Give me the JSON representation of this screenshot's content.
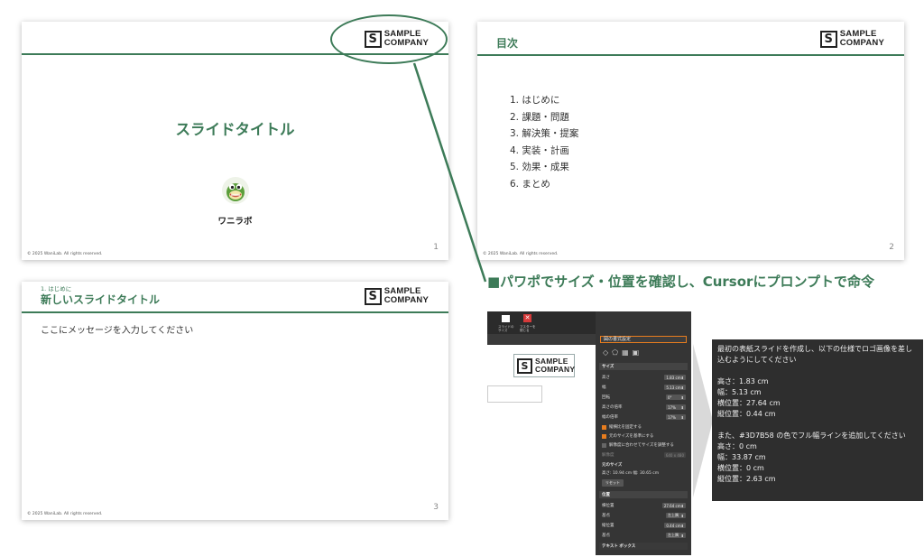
{
  "brand": {
    "mark": "S",
    "line1": "SAMPLE",
    "line2": "COMPANY",
    "accent": "#3D7B58"
  },
  "slide1": {
    "title": "スライドタイトル",
    "author": "ワニラボ",
    "page": "1",
    "copyright": "© 2025 WaniLab. All rights reserved.",
    "avatar_icon": "crocodile-mascot-icon"
  },
  "slide2": {
    "title": "目次",
    "page": "2",
    "copyright": "© 2025 WaniLab. All rights reserved.",
    "items": [
      "1. はじめに",
      "2. 課題・問題",
      "3. 解決策・提案",
      "4. 実装・計画",
      "5. 効果・成果",
      "6. まとめ"
    ]
  },
  "slide3": {
    "section": "1. はじめに",
    "title": "新しいスライドタイトル",
    "message": "ここにメッセージを入力してください",
    "page": "3",
    "copyright": "© 2025 WaniLab. All rights reserved."
  },
  "heading": "■パワポでサイズ・位置を確認し、Cursorにプロンプトで命令",
  "ppt": {
    "toolbar": {
      "btn1": "スライドのサイズ",
      "btn2": "マスターを閉じる"
    },
    "pane_title": "図の書式設定",
    "size_section": "サイズ",
    "height_label": "高さ",
    "height_value": "1.83 cm",
    "width_label": "幅",
    "width_value": "5.13 cm",
    "rotation_label": "回転",
    "rotation_value": "0°",
    "scale_h_label": "高さの倍率",
    "scale_h_value": "17%",
    "scale_w_label": "幅の倍率",
    "scale_w_value": "17%",
    "check1": "縦横比を固定する",
    "check2": "元のサイズを基準にする",
    "check3": "解像度に合わせてサイズを調整する",
    "resolution_label": "解像度",
    "resolution_value": "640 x 480",
    "original_label": "元のサイズ",
    "original_value": "高さ: 10.94 cm   幅: 30.65 cm",
    "reset": "リセット",
    "position_section": "位置",
    "hpos_label": "横位置",
    "hpos_value": "27.64 cm",
    "hfrom_label": "基点",
    "hfrom_value": "左上隅",
    "vpos_label": "縦位置",
    "vpos_value": "0.44 cm",
    "vfrom_label": "基点",
    "vfrom_value": "左上隅",
    "textbox_section": "テキスト ボックス"
  },
  "prompt": {
    "text": "最初の表紙スライドを作成し、以下の仕様でロゴ画像を差し込むようにしてください\n\n高さ：1.83 cm\n幅：5.13 cm\n横位置：27.64 cm\n縦位置：0.44 cm\n\nまた、#3D7B58 の色でフル幅ラインを追加してください\n高さ：0 cm\n幅：33.87 cm\n横位置：0 cm\n縦位置：2.63 cm"
  }
}
